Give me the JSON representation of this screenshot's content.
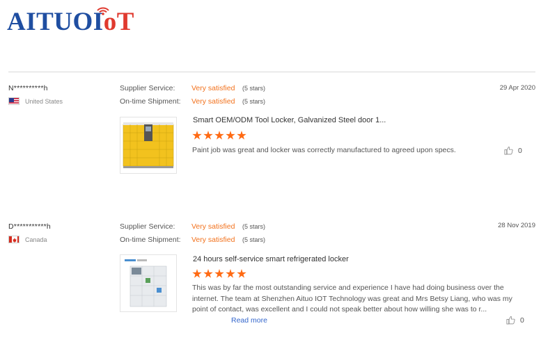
{
  "brand": {
    "logo_blue": "AITUOI",
    "logo_red": "oT",
    "blue": "#1f4ea1",
    "red": "#e03a2f"
  },
  "labels": {
    "supplier_service": "Supplier Service:",
    "ontime_shipment": "On-time Shipment:"
  },
  "reviews": [
    {
      "buyer": "N**********h",
      "country": "United States",
      "flag_icon": "us-flag-icon",
      "supplier_service": "Very satisfied",
      "supplier_stars": "(5 stars)",
      "shipment": "Very satisfied",
      "shipment_stars": "(5 stars)",
      "date": "29 Apr 2020",
      "product_title": "Smart OEM/ODM Tool Locker, Galvanized Steel door 1...",
      "rating": 5,
      "comment": "Paint job was great and locker was correctly manufactured to agreed upon specs.",
      "likes": "0"
    },
    {
      "buyer": "D***********h",
      "country": "Canada",
      "flag_icon": "canada-flag-icon",
      "supplier_service": "Very satisfied",
      "supplier_stars": "(5 stars)",
      "shipment": "Very satisfied",
      "shipment_stars": "(5 stars)",
      "date": "28 Nov 2019",
      "product_title": "24 hours self-service smart refrigerated locker",
      "rating": 5,
      "comment": "This was by far the most outstanding service and experience I have had doing business over the internet. The team at Shenzhen Aituo IOT Technology was great and Mrs Betsy Liang, who was my point of contact, was excellent and I could not speak better about how willing she was to r...",
      "read_more": "Read more",
      "likes": "0"
    }
  ],
  "colors": {
    "accent_orange": "#f2711c",
    "star_orange": "#ff6a13",
    "link_blue": "#3366cc"
  }
}
